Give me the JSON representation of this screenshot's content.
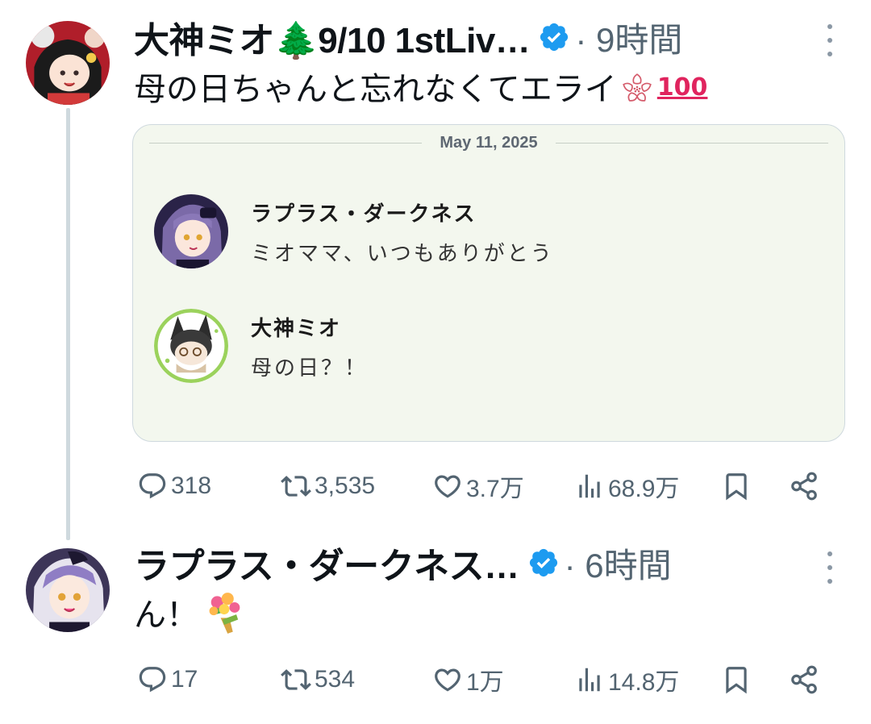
{
  "tweets": [
    {
      "author": "大神ミオ🌲9/10 1stLiv…",
      "time": "· 9時間",
      "text": "母の日ちゃんと忘れなくてエライ",
      "emoji_hundred": "100",
      "icons": [
        "more-icon",
        "verified-badge-icon",
        "cherry-blossom-icon",
        "hundred-points-icon"
      ],
      "embedded_chat": {
        "date": "May 11, 2025",
        "messages": [
          {
            "name": "ラプラス・ダークネス",
            "text": "ミオママ、いつもありがとう"
          },
          {
            "name": "大神ミオ",
            "text": "母の日？！"
          }
        ]
      },
      "stats": {
        "replies": "318",
        "reposts": "3,535",
        "likes": "3.7万",
        "views": "68.9万"
      }
    },
    {
      "author": "ラプラス・ダークネス…",
      "time": "· 6時間",
      "text": "ん！",
      "icons": [
        "more-icon",
        "verified-badge-icon",
        "bouquet-icon"
      ],
      "stats": {
        "replies": "17",
        "reposts": "534",
        "likes": "1万",
        "views": "14.8万"
      }
    }
  ],
  "colors": {
    "verified": "#1d9bf0",
    "muted": "#536471",
    "card_bg": "#f3f7ee",
    "thread_line": "#cfd9de"
  }
}
